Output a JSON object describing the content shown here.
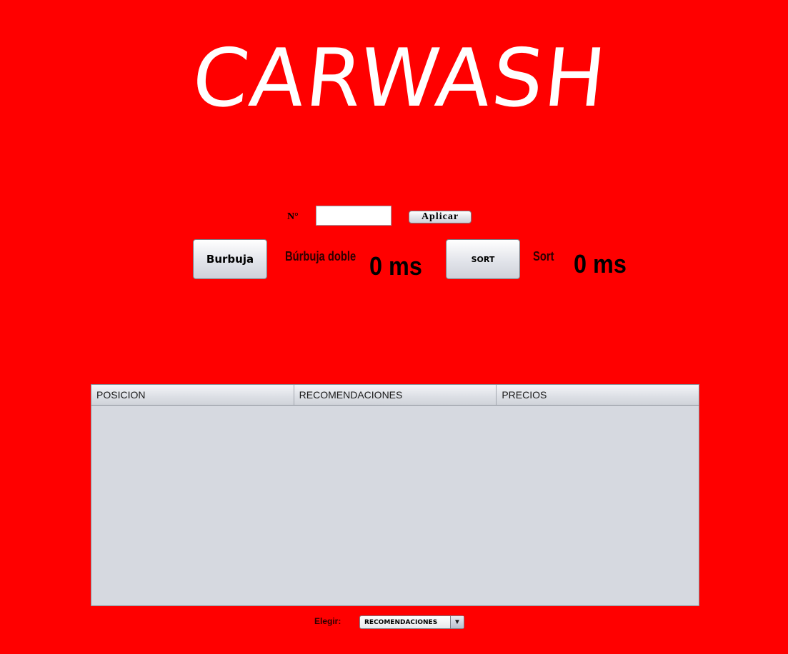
{
  "app": {
    "title": "CARWASH"
  },
  "controls": {
    "n_label": "N°",
    "n_input_value": "",
    "apply_label": "Aplicar",
    "burbuja_label": "Burbuja",
    "burbuja_doble_label": "Búrbuja doble",
    "burbuja_time": "0 ms",
    "sort_button_label": "SORT",
    "sort_label": "Sort",
    "sort_time": "0 ms"
  },
  "table": {
    "columns": [
      "POSICION",
      "RECOMENDACIONES",
      "PRECIOS"
    ],
    "rows": []
  },
  "footer": {
    "choose_label": "Elegir:",
    "choose_selected": "RECOMENDACIONES",
    "arrow_icon": "chevron-down-icon"
  },
  "colors": {
    "background": "#ff0000",
    "title": "#ffffff"
  }
}
